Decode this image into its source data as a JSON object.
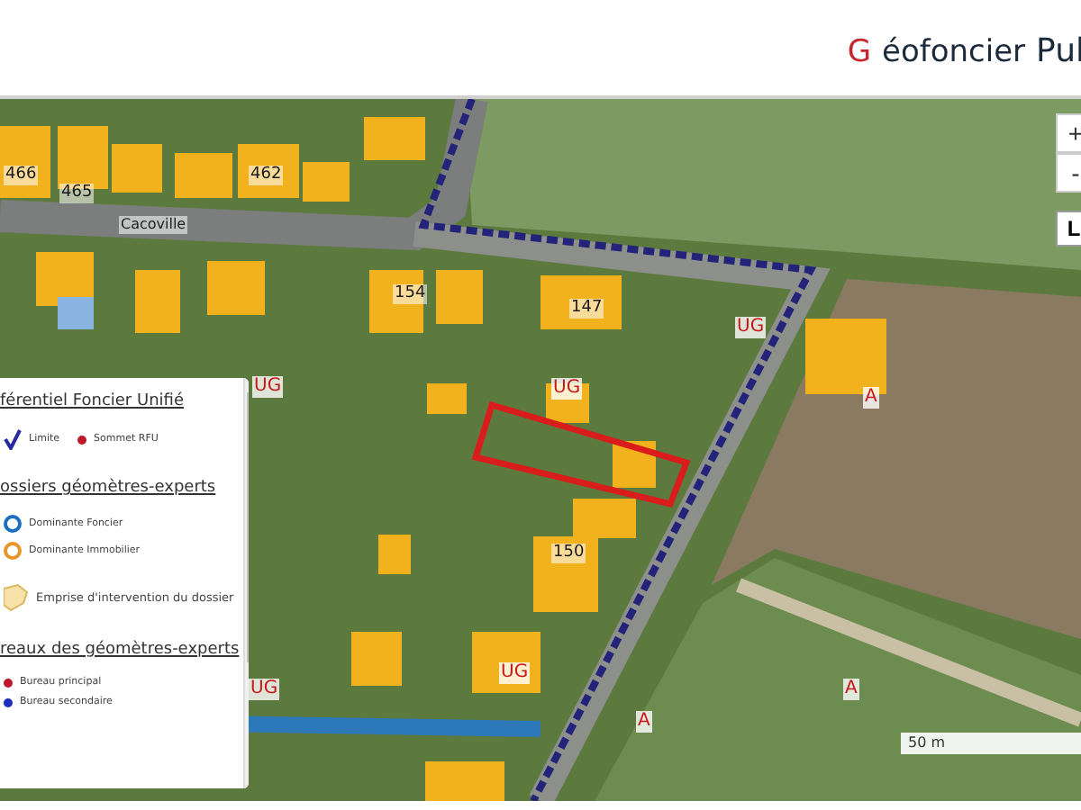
{
  "header": {
    "brand_initial": "G",
    "brand_rest": "éofoncier",
    "brand_suffix": "Pul"
  },
  "map": {
    "labels": [
      {
        "text": "466",
        "kind": "parcel"
      },
      {
        "text": "465",
        "kind": "parcel"
      },
      {
        "text": "462",
        "kind": "parcel"
      },
      {
        "text": "Cacoville",
        "kind": "street"
      },
      {
        "text": "154",
        "kind": "parcel"
      },
      {
        "text": "147",
        "kind": "parcel"
      },
      {
        "text": "UG",
        "kind": "zone"
      },
      {
        "text": "UG",
        "kind": "zone"
      },
      {
        "text": "UG",
        "kind": "zone"
      },
      {
        "text": "A",
        "kind": "zone"
      },
      {
        "text": "150",
        "kind": "parcel"
      },
      {
        "text": "UG",
        "kind": "zone"
      },
      {
        "text": "UG",
        "kind": "zone"
      },
      {
        "text": "A",
        "kind": "zone"
      },
      {
        "text": "A",
        "kind": "zone"
      }
    ],
    "zoom_in": "+",
    "zoom_out": "-",
    "layers": "L",
    "scale": "50 m"
  },
  "legend": {
    "sections": [
      {
        "title": "férentiel Foncier Unifié",
        "items": [
          {
            "kind": "line",
            "label": "Limite"
          },
          {
            "kind": "dot",
            "label": "Sommet RFU",
            "color": "#c0182a"
          }
        ]
      },
      {
        "title": "ossiers géomètres-experts",
        "items": [
          {
            "kind": "ring",
            "label": "Dominante Foncier",
            "color": "#1e6fc0"
          },
          {
            "kind": "ring",
            "label": "Dominante Immobilier",
            "color": "#e8962a"
          },
          {
            "kind": "area",
            "label": "Emprise d'intervention du dossier"
          }
        ]
      },
      {
        "title": "reaux des géomètres-experts",
        "items": [
          {
            "kind": "dot",
            "label": "Bureau principal",
            "color": "#c0182a"
          },
          {
            "kind": "dot",
            "label": "Bureau secondaire",
            "color": "#1a2fc0"
          }
        ]
      }
    ]
  }
}
